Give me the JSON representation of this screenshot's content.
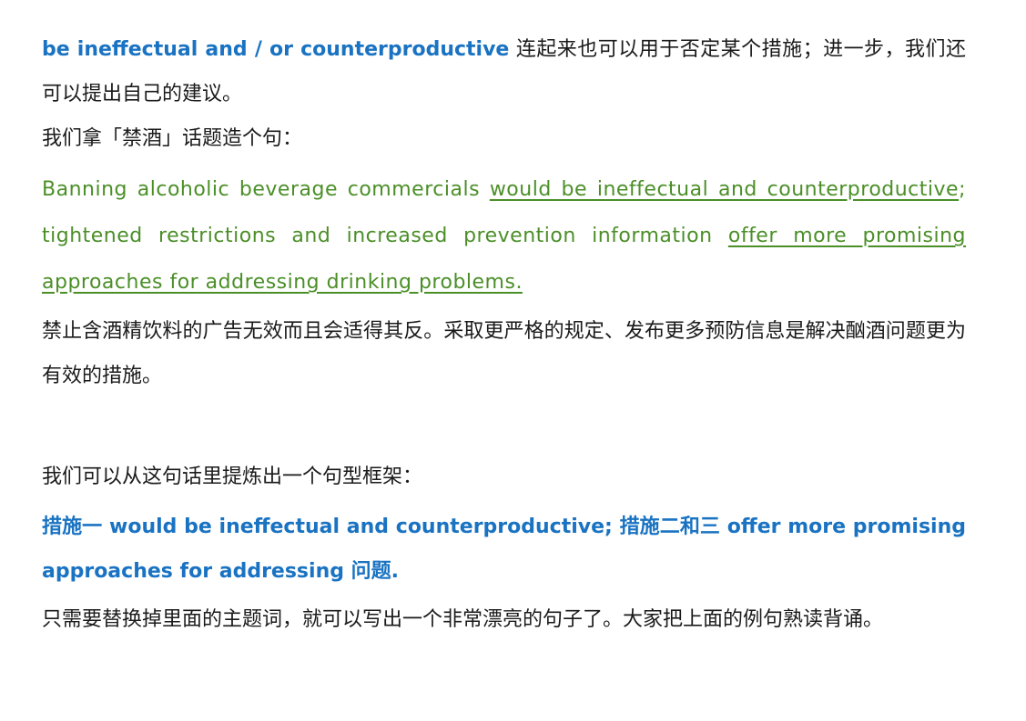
{
  "intro": {
    "phrase": "be ineffectual and / or counterproductive",
    "text": " 连起来也可以用于否定某个措施；进一步，我们还可以提出自己的建议。"
  },
  "topic_line": "我们拿「禁酒」话题造个句：",
  "example": {
    "part1": "Banning alcoholic beverage commercials ",
    "part2_underlined": "would be ineffectual and counterproductive",
    "part3": "; tightened restrictions and increased prevention information ",
    "part4_underlined": "offer more promising approaches for addressing drinking problems."
  },
  "translation": "禁止含酒精饮料的广告无效而且会适得其反。采取更严格的规定、发布更多预防信息是解决酗酒问题更为有效的措施。",
  "frame_intro": "我们可以从这句话里提炼出一个句型框架：",
  "frame": "措施一 would be ineffectual and counterproductive; 措施二和三 offer more promising approaches for addressing 问题.",
  "outro": "只需要替换掉里面的主题词，就可以写出一个非常漂亮的句子了。大家把上面的例句熟读背诵。",
  "colors": {
    "blue": "#1a73c2",
    "green": "#4b8f28",
    "text": "#1a1a1a"
  }
}
